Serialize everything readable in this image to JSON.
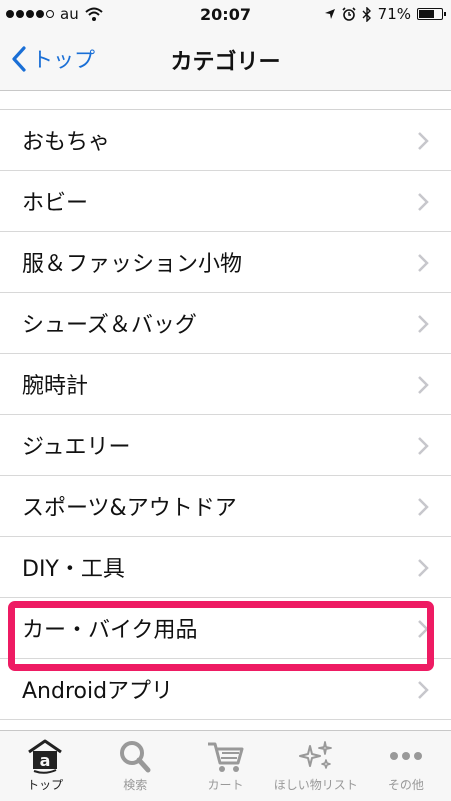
{
  "status": {
    "carrier": "au",
    "time": "20:07",
    "battery": "71%",
    "battery_level": 0.71
  },
  "nav": {
    "back_label": "トップ",
    "title": "カテゴリー"
  },
  "list": {
    "items": [
      "おもちゃ",
      "ホビー",
      "服＆ファッション小物",
      "シューズ＆バッグ",
      "腕時計",
      "ジュエリー",
      "スポーツ&アウトドア",
      "DIY・工具",
      "カー・バイク用品",
      "Androidアプリ"
    ],
    "highlighted_index": 8
  },
  "tabbar": {
    "items": [
      "トップ",
      "検索",
      "カート",
      "ほしい物リスト",
      "その他"
    ]
  },
  "colors": {
    "accent": "#1a6fd6",
    "highlight": "#ee1b63"
  }
}
